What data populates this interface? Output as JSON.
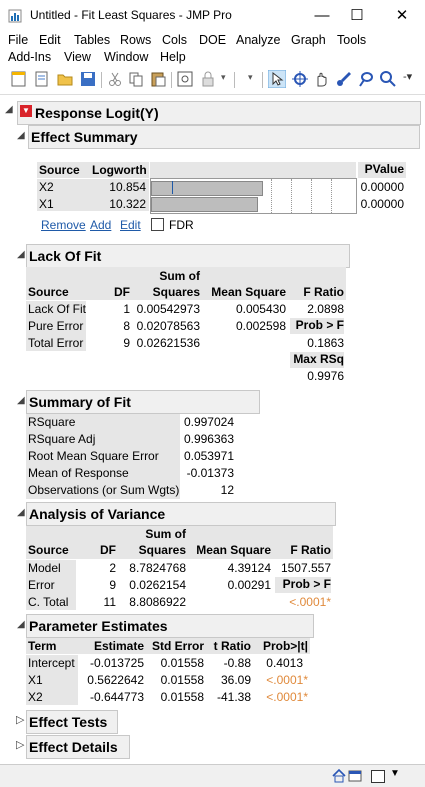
{
  "window": {
    "title": "Untitled - Fit Least Squares - JMP Pro",
    "minimize": "—",
    "maximize": "☐",
    "close": "✕"
  },
  "menu": [
    "File",
    "Edit",
    "Tables",
    "Rows",
    "Cols",
    "DOE",
    "Analyze",
    "Graph",
    "Tools",
    "Add-Ins",
    "View",
    "Window",
    "Help"
  ],
  "report": {
    "title": "Response Logit(Y)",
    "effect_summary": {
      "title": "Effect Summary",
      "headers": {
        "source": "Source",
        "logworth": "Logworth",
        "pvalue": "PValue"
      },
      "rows": [
        {
          "source": "X2",
          "logworth": "10.854",
          "pvalue": "0.00000",
          "bar": 0.83
        },
        {
          "source": "X1",
          "logworth": "10.322",
          "pvalue": "0.00000",
          "bar": 0.79
        }
      ],
      "remove": "Remove",
      "add": "Add",
      "edit": "Edit",
      "fdr": "FDR"
    },
    "lack_of_fit": {
      "title": "Lack Of Fit",
      "headers": {
        "source": "Source",
        "df": "DF",
        "ss1": "Sum of",
        "ss2": "Squares",
        "ms": "Mean Square",
        "f": "F Ratio"
      },
      "rows": [
        {
          "source": "Lack Of Fit",
          "df": "1",
          "ss": "0.00542973",
          "ms": "0.005430",
          "f": "2.0898"
        },
        {
          "source": "Pure Error",
          "df": "8",
          "ss": "0.02078563",
          "ms": "0.002598",
          "f": "Prob > F"
        },
        {
          "source": "Total Error",
          "df": "9",
          "ss": "0.02621536",
          "ms": "",
          "f": "0.1863"
        }
      ],
      "maxrsq_label": "Max RSq",
      "maxrsq": "0.9976"
    },
    "summary_of_fit": {
      "title": "Summary of Fit",
      "rows": [
        {
          "k": "RSquare",
          "v": "0.997024"
        },
        {
          "k": "RSquare Adj",
          "v": "0.996363"
        },
        {
          "k": "Root Mean Square Error",
          "v": "0.053971"
        },
        {
          "k": "Mean of Response",
          "v": "-0.01373"
        },
        {
          "k": "Observations (or Sum Wgts)",
          "v": "12"
        }
      ]
    },
    "anova": {
      "title": "Analysis of Variance",
      "headers": {
        "source": "Source",
        "df": "DF",
        "ss1": "Sum of",
        "ss2": "Squares",
        "ms": "Mean Square",
        "f": "F Ratio"
      },
      "rows": [
        {
          "source": "Model",
          "df": "2",
          "ss": "8.7824768",
          "ms": "4.39124",
          "f": "1507.557"
        },
        {
          "source": "Error",
          "df": "9",
          "ss": "0.0262154",
          "ms": "0.00291",
          "f": "Prob > F"
        },
        {
          "source": "C. Total",
          "df": "11",
          "ss": "8.8086922",
          "ms": "",
          "f": "<.0001*"
        }
      ]
    },
    "param_estimates": {
      "title": "Parameter Estimates",
      "headers": {
        "term": "Term",
        "est": "Estimate",
        "se": "Std Error",
        "t": "t Ratio",
        "p": "Prob>|t|"
      },
      "rows": [
        {
          "term": "Intercept",
          "est": "-0.013725",
          "se": "0.01558",
          "t": "-0.88",
          "p": "0.4013"
        },
        {
          "term": "X1",
          "est": "0.5622642",
          "se": "0.01558",
          "t": "36.09",
          "p": "<.0001*"
        },
        {
          "term": "X2",
          "est": "-0.644773",
          "se": "0.01558",
          "t": "-41.38",
          "p": "<.0001*"
        }
      ]
    },
    "effect_tests": "Effect Tests",
    "effect_details": "Effect Details"
  },
  "colors": {
    "accent": "#e08a3c",
    "link": "#1f5aa8",
    "red": "#d9232a"
  }
}
